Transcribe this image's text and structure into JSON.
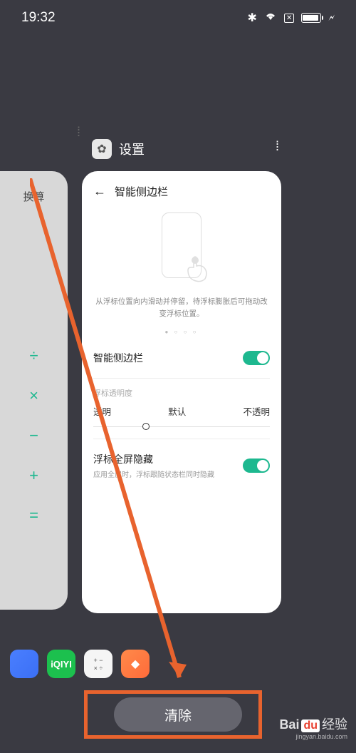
{
  "status": {
    "time": "19:32"
  },
  "leftCard": {
    "title": "换算",
    "ops": [
      "÷",
      "×",
      "−",
      "+",
      "="
    ]
  },
  "recents": {
    "appName": "设置",
    "clearLabel": "清除"
  },
  "settingsCard": {
    "title": "智能侧边栏",
    "instruction": "从浮标位置向内滑动并停留，待浮标膨胀后可拖动改变浮标位置。",
    "smartSidebar": {
      "label": "智能侧边栏"
    },
    "opacity": {
      "section": "浮标透明度",
      "transparent": "透明",
      "default": "默认",
      "opaque": "不透明"
    },
    "fullscreen": {
      "label": "浮标全屏隐藏",
      "sub": "应用全屏时，浮标跟随状态栏同时隐藏"
    }
  },
  "dock": {
    "iqiyi": "iQIYI"
  },
  "watermark": {
    "brand1": "Bai",
    "brand2": "du",
    "brand3": "经验",
    "url": "jingyan.baidu.com"
  }
}
